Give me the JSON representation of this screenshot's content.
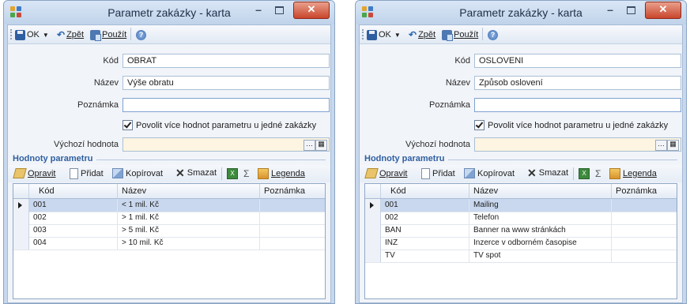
{
  "colors": {
    "accent": "#2f5fa1",
    "selection": "#c9d8ee",
    "close": "#c9462c"
  },
  "windows": [
    {
      "title": "Parametr zakázky - karta",
      "toolbar": {
        "ok": "OK",
        "zpet": "Zpět",
        "pouzit": "Použít"
      },
      "labels": {
        "kod": "Kód",
        "nazev": "Název",
        "poznamka": "Poznámka",
        "vychozi": "Výchozí hodnota"
      },
      "fields": {
        "kod": "OBRAT",
        "nazev": "Výše obratu",
        "poznamka": "",
        "vychozi": ""
      },
      "checkbox": "Povolit více hodnot parametru u jedné zakázky",
      "section": "Hodnoty parametru",
      "grid_toolbar": {
        "opravit": "Opravit",
        "pridat": "Přidat",
        "kopirovat": "Kopírovat",
        "smazat": "Smazat",
        "legenda": "Legenda"
      },
      "columns": [
        "Kód",
        "Název",
        "Poznámka"
      ],
      "rows": [
        {
          "kod": "001",
          "nazev": "< 1 mil. Kč",
          "poznamka": ""
        },
        {
          "kod": "002",
          "nazev": "> 1 mil. Kč",
          "poznamka": ""
        },
        {
          "kod": "003",
          "nazev": "> 5 mil. Kč",
          "poznamka": ""
        },
        {
          "kod": "004",
          "nazev": "> 10 mil. Kč",
          "poznamka": ""
        }
      ]
    },
    {
      "title": "Parametr zakázky - karta",
      "toolbar": {
        "ok": "OK",
        "zpet": "Zpět",
        "pouzit": "Použít"
      },
      "labels": {
        "kod": "Kód",
        "nazev": "Název",
        "poznamka": "Poznámka",
        "vychozi": "Výchozí hodnota"
      },
      "fields": {
        "kod": "OSLOVENI",
        "nazev": "Způsob oslovení",
        "poznamka": "",
        "vychozi": ""
      },
      "checkbox": "Povolit více hodnot parametru u jedné zakázky",
      "section": "Hodnoty parametru",
      "grid_toolbar": {
        "opravit": "Opravit",
        "pridat": "Přidat",
        "kopirovat": "Kopírovat",
        "smazat": "Smazat",
        "legenda": "Legenda"
      },
      "columns": [
        "Kód",
        "Název",
        "Poznámka"
      ],
      "rows": [
        {
          "kod": "001",
          "nazev": "Mailing",
          "poznamka": ""
        },
        {
          "kod": "002",
          "nazev": "Telefon",
          "poznamka": ""
        },
        {
          "kod": "BAN",
          "nazev": "Banner na www stránkách",
          "poznamka": ""
        },
        {
          "kod": "INZ",
          "nazev": "Inzerce v odborném časopise",
          "poznamka": ""
        },
        {
          "kod": "TV",
          "nazev": "TV spot",
          "poznamka": ""
        }
      ]
    }
  ]
}
